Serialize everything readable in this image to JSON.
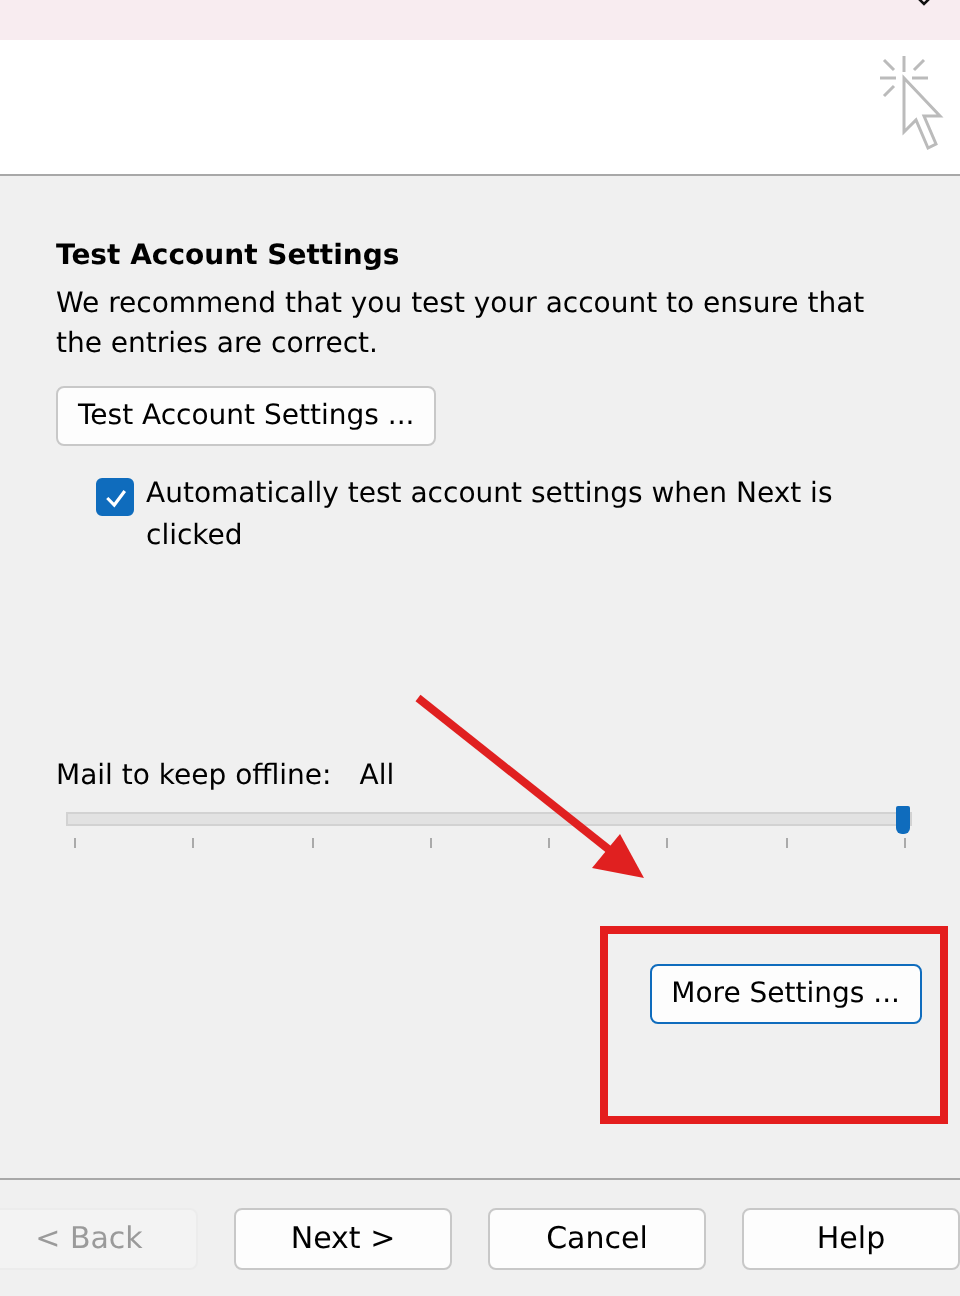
{
  "section": {
    "title": "Test Account Settings",
    "description": "We recommend that you test your account to ensure that the entries are correct.",
    "test_button": "Test Account Settings ...",
    "auto_test": {
      "label": "Automatically test account settings when Next is clicked",
      "checked": true
    }
  },
  "offline": {
    "label": "Mail to keep offline:",
    "value": "All",
    "level": 1
  },
  "more_settings": "More Settings ...",
  "buttons": [
    {
      "label": "< Back",
      "disabled": true
    },
    {
      "label": "Next >",
      "disabled": false
    },
    {
      "label": "Cancel",
      "disabled": false
    },
    {
      "label": "Help",
      "disabled": false
    }
  ]
}
